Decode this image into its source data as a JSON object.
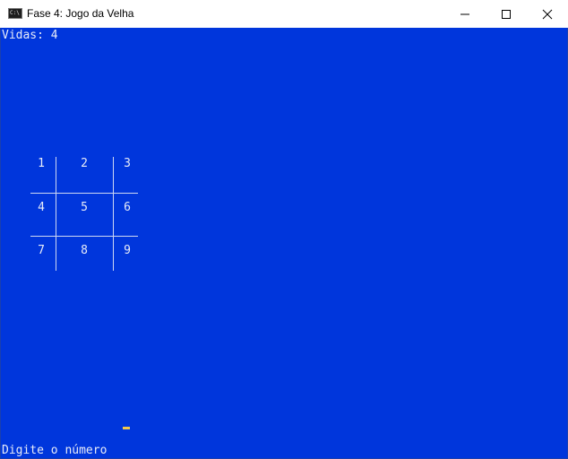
{
  "window": {
    "title": "Fase 4: Jogo da Velha",
    "icon": "console-icon",
    "icon_glyph": "C:\\",
    "controls": [
      "minimize-icon",
      "maximize-icon",
      "close-icon"
    ]
  },
  "console": {
    "background": "#0036dc",
    "text_color": "#e8ecf8",
    "lives_text": "Vidas: 4",
    "board": {
      "cells": [
        "1",
        "2",
        "3",
        "4",
        "5",
        "6",
        "7",
        "8",
        "9"
      ]
    },
    "prompt_text": "Digite o número",
    "cursor_color": "#f2c94c"
  }
}
